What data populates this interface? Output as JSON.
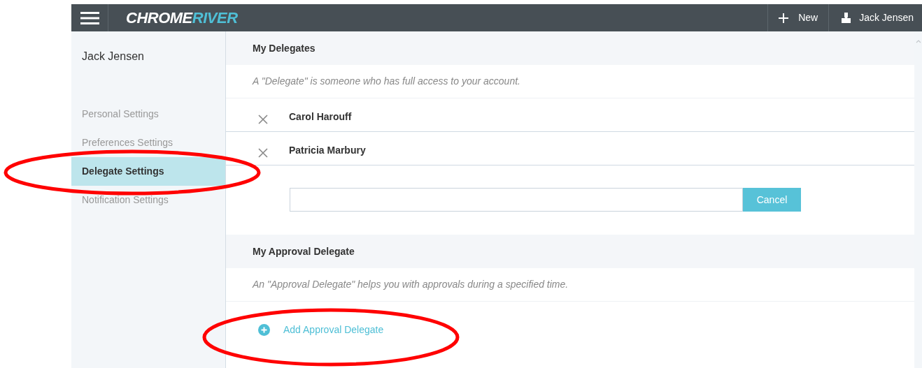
{
  "topbar": {
    "logo": {
      "first": "CHROME",
      "second": "RIVER"
    },
    "new_label": "New",
    "user_name": "Jack Jensen"
  },
  "sidebar": {
    "user_name": "Jack Jensen",
    "items": [
      {
        "label": "Personal Settings",
        "selected": false
      },
      {
        "label": "Preferences Settings",
        "selected": false
      },
      {
        "label": "Delegate Settings",
        "selected": true
      },
      {
        "label": "Notification Settings",
        "selected": false
      }
    ]
  },
  "delegates": {
    "title": "My Delegates",
    "description": "A \"Delegate\" is someone who has full access to your account.",
    "people": [
      {
        "name": "Carol Harouff"
      },
      {
        "name": "Patricia Marbury"
      }
    ],
    "cancel_label": "Cancel"
  },
  "approval": {
    "title": "My Approval Delegate",
    "description": "An \"Approval Delegate\" helps you with approvals during a specified time.",
    "add_label": "Add Approval Delegate"
  }
}
